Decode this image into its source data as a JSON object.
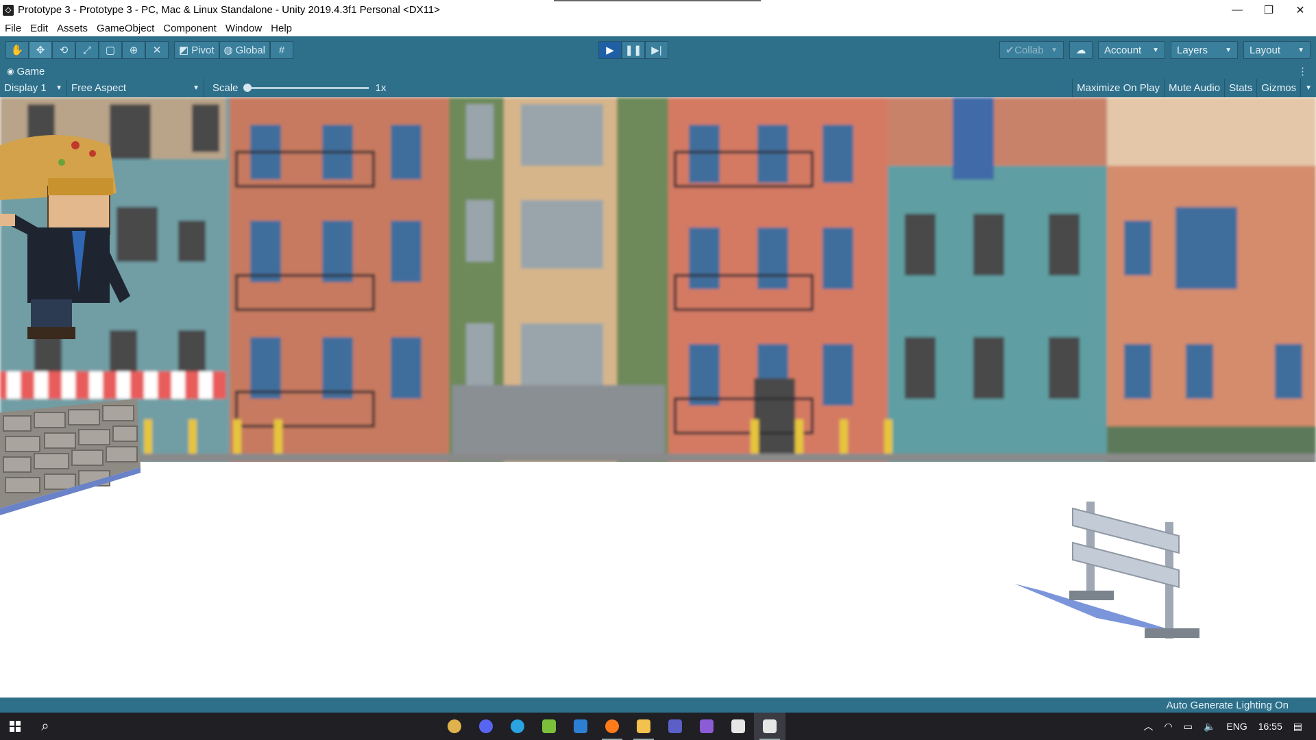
{
  "window": {
    "title": "Prototype 3 - Prototype 3 - PC, Mac & Linux Standalone - Unity 2019.4.3f1 Personal <DX11>",
    "controls": {
      "minimize": "—",
      "restore": "❐",
      "close": "✕"
    }
  },
  "menu": [
    "File",
    "Edit",
    "Assets",
    "GameObject",
    "Component",
    "Window",
    "Help"
  ],
  "toolbar": {
    "tools": [
      "hand-tool-icon",
      "move-tool-icon",
      "rotate-tool-icon",
      "scale-tool-icon",
      "rect-tool-icon",
      "transform-tool-icon",
      "custom-tool-icon"
    ],
    "pivot_label": "Pivot",
    "global_label": "Global",
    "collab_label": "Collab",
    "account_label": "Account",
    "layers_label": "Layers",
    "layout_label": "Layout"
  },
  "game_panel": {
    "tab_label": "Game",
    "display_label": "Display 1",
    "aspect_label": "Free Aspect",
    "scale_label": "Scale",
    "scale_value": "1x",
    "maximize_label": "Maximize On Play",
    "mute_label": "Mute Audio",
    "stats_label": "Stats",
    "gizmos_label": "Gizmos"
  },
  "status": {
    "text": "Auto Generate Lighting On"
  },
  "taskbar": {
    "apps": [
      {
        "name": "slack-icon",
        "color": "#e0b24d"
      },
      {
        "name": "discord-icon",
        "color": "#5865f2"
      },
      {
        "name": "telegram-icon",
        "color": "#2aa3e0"
      },
      {
        "name": "bluestacks-icon",
        "color": "#7bbf3b"
      },
      {
        "name": "mail-icon",
        "color": "#2d7fd3"
      },
      {
        "name": "firefox-icon",
        "color": "#ff7a1a"
      },
      {
        "name": "file-explorer-icon",
        "color": "#f2c14e"
      },
      {
        "name": "teams-icon",
        "color": "#5b5fc7"
      },
      {
        "name": "visual-studio-icon",
        "color": "#8c5bd6"
      },
      {
        "name": "unity-hub-icon",
        "color": "#e6e6e6"
      },
      {
        "name": "unity-icon",
        "color": "#e6e6e6"
      }
    ],
    "lang": "ENG",
    "time": "16:55"
  }
}
